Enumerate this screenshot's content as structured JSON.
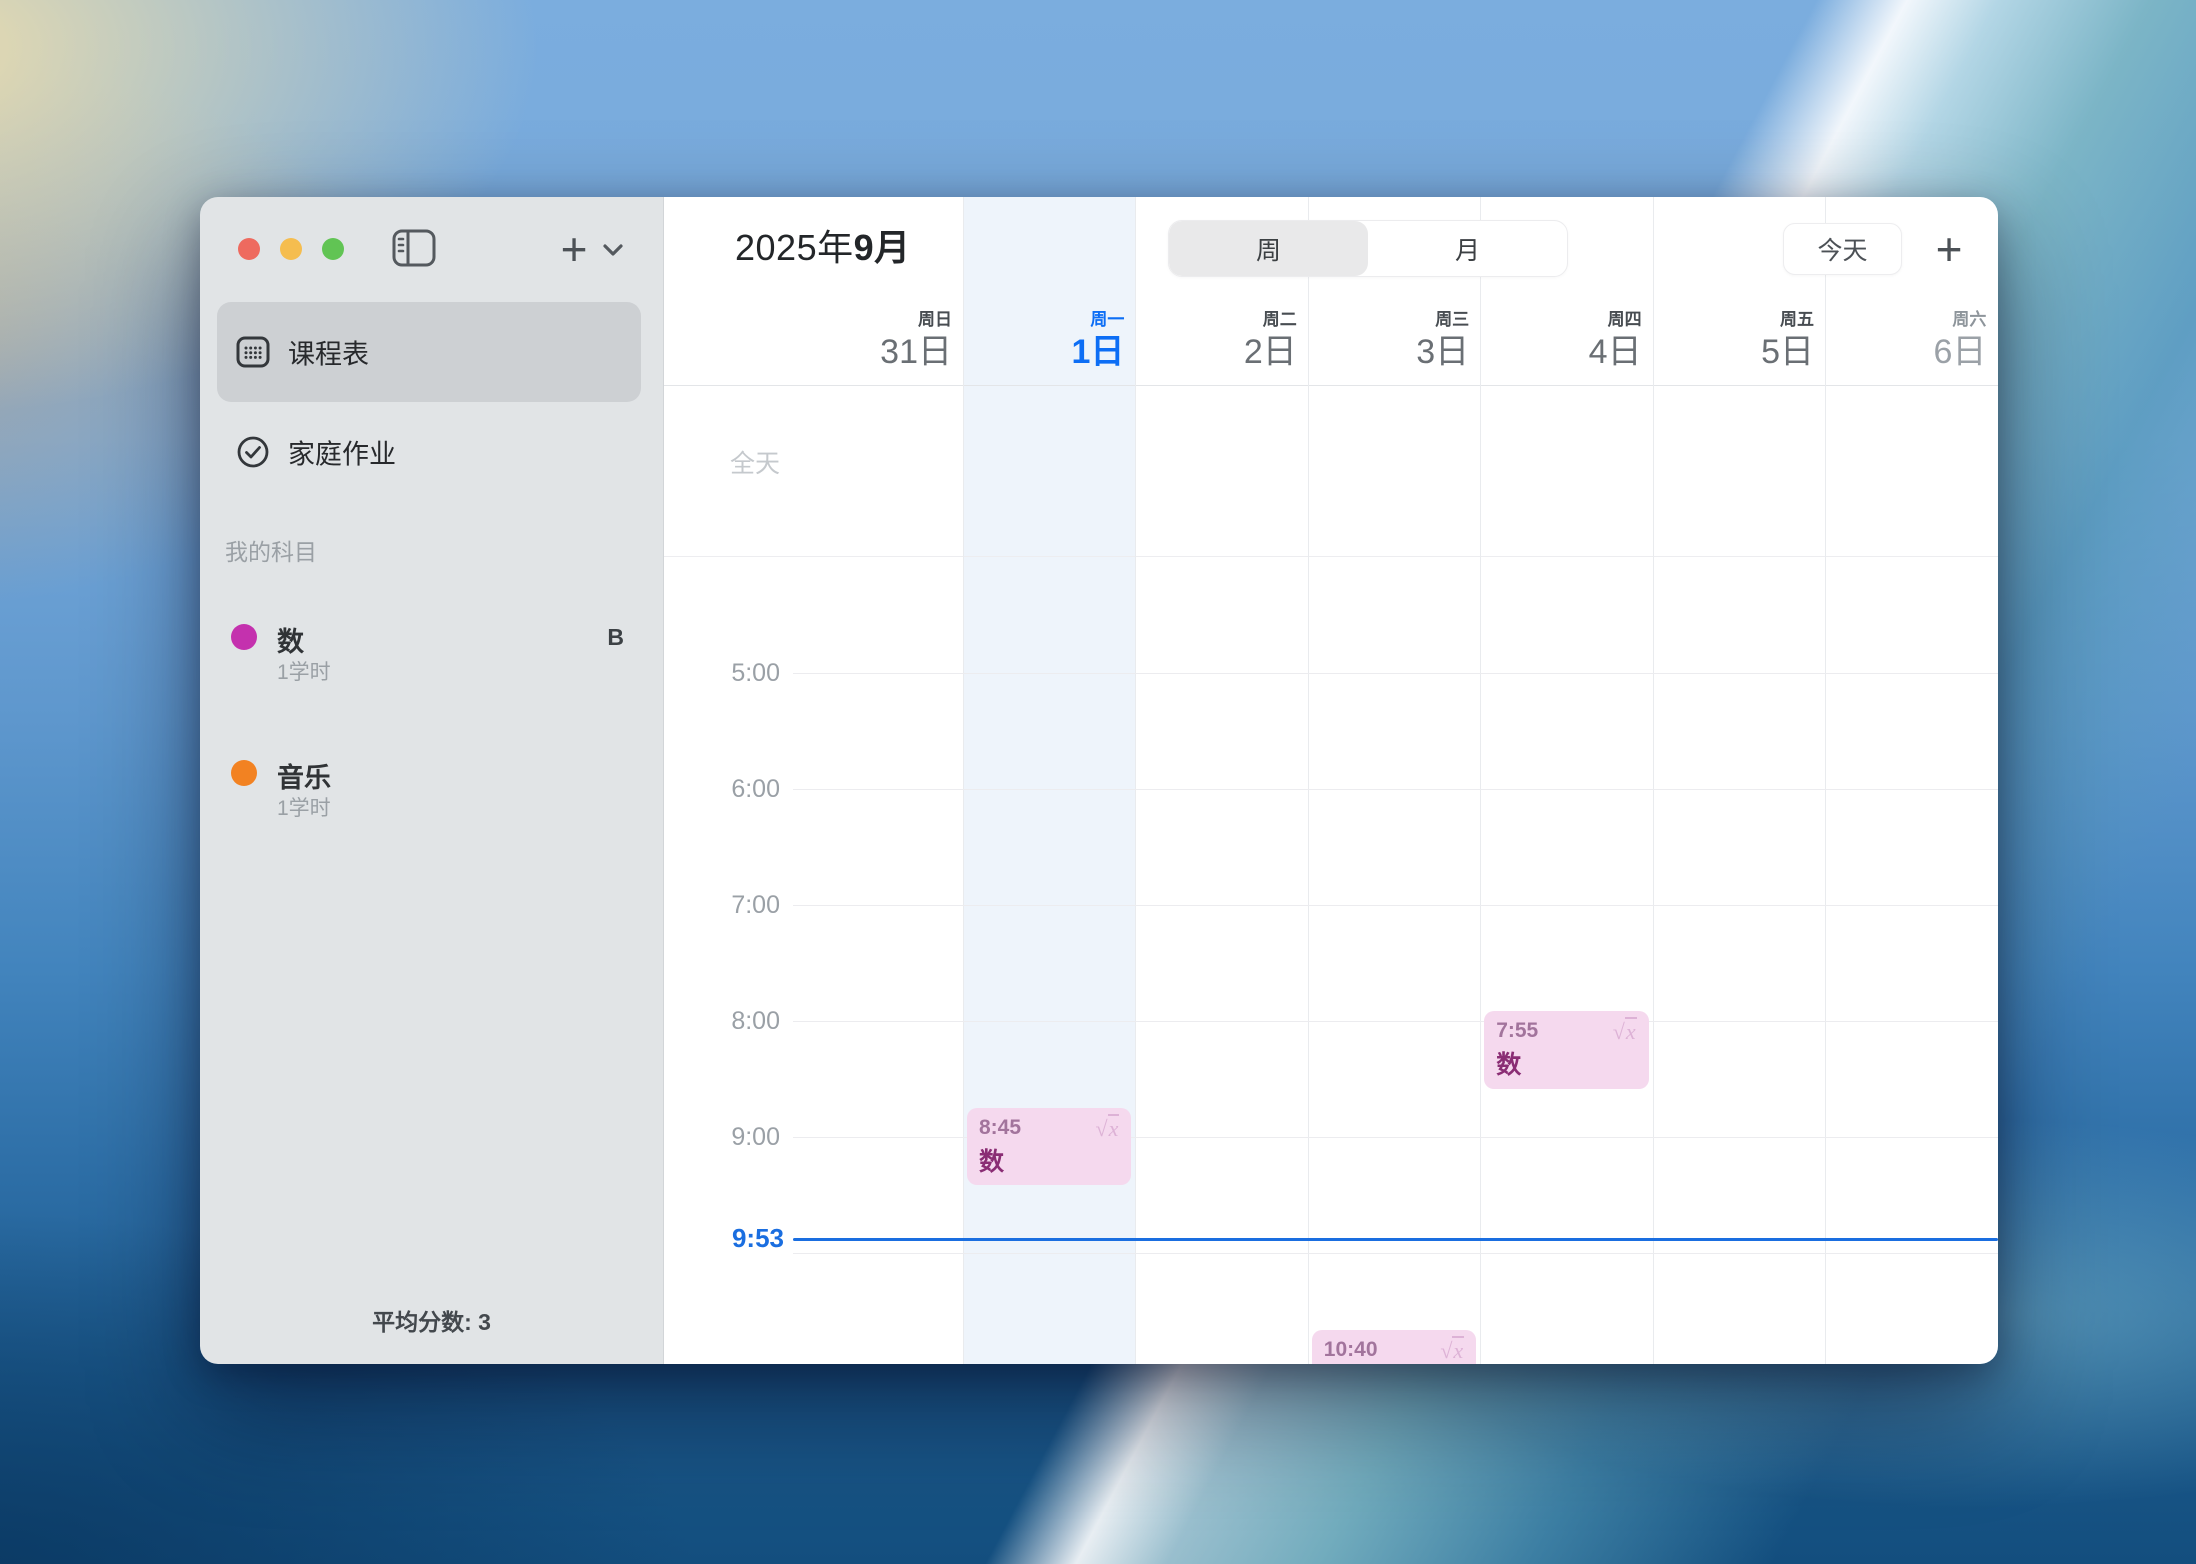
{
  "sidebar": {
    "nav_items": [
      {
        "label": "课程表",
        "icon": "calendar-grid-icon",
        "selected": true
      },
      {
        "label": "家庭作业",
        "icon": "circle-check-icon",
        "selected": false
      }
    ],
    "section_title": "我的科目",
    "subjects": [
      {
        "name": "数",
        "meta": "1学时",
        "grade": "B",
        "color": "#c431ae"
      },
      {
        "name": "音乐",
        "meta": "1学时",
        "grade": "",
        "color": "#f28222"
      }
    ],
    "footer_label": "平均分数: 3"
  },
  "header": {
    "title_prefix": "2025年",
    "title_month": "9月",
    "view_segments": [
      {
        "label": "周",
        "selected": true
      },
      {
        "label": "月",
        "selected": false
      }
    ],
    "today_label": "今天",
    "add_label": "+"
  },
  "toolbar": {
    "add_label": "+"
  },
  "calendar": {
    "all_day_label": "全天",
    "days": [
      {
        "weekday": "周日",
        "date": "31日",
        "today": false,
        "muted": false
      },
      {
        "weekday": "周一",
        "date": "1日",
        "today": true,
        "muted": false
      },
      {
        "weekday": "周二",
        "date": "2日",
        "today": false,
        "muted": false
      },
      {
        "weekday": "周三",
        "date": "3日",
        "today": false,
        "muted": false
      },
      {
        "weekday": "周四",
        "date": "4日",
        "today": false,
        "muted": false
      },
      {
        "weekday": "周五",
        "date": "5日",
        "today": false,
        "muted": false
      },
      {
        "weekday": "周六",
        "date": "6日",
        "today": false,
        "muted": true
      }
    ],
    "hour_labels": [
      "5:00",
      "6:00",
      "7:00",
      "8:00",
      "9:00"
    ],
    "now": {
      "label": "9:53",
      "time": "9:53"
    },
    "events": [
      {
        "day_index": 1,
        "start": "8:45",
        "duration_min": 40,
        "title": "数",
        "icon": "sqrt-x-icon"
      },
      {
        "day_index": 3,
        "start": "10:40",
        "duration_min": 40,
        "title": "",
        "icon": "sqrt-x-icon"
      },
      {
        "day_index": 4,
        "start": "7:55",
        "duration_min": 40,
        "title": "数",
        "icon": "sqrt-x-icon"
      }
    ],
    "colors": {
      "accent_blue": "#1a6ee0",
      "today_blue": "#0d6ef5",
      "event_bg": "#f5d9ee",
      "event_time": "#a2749c",
      "event_title": "#8a2d74",
      "event_icon": "#ddb2d6"
    }
  }
}
